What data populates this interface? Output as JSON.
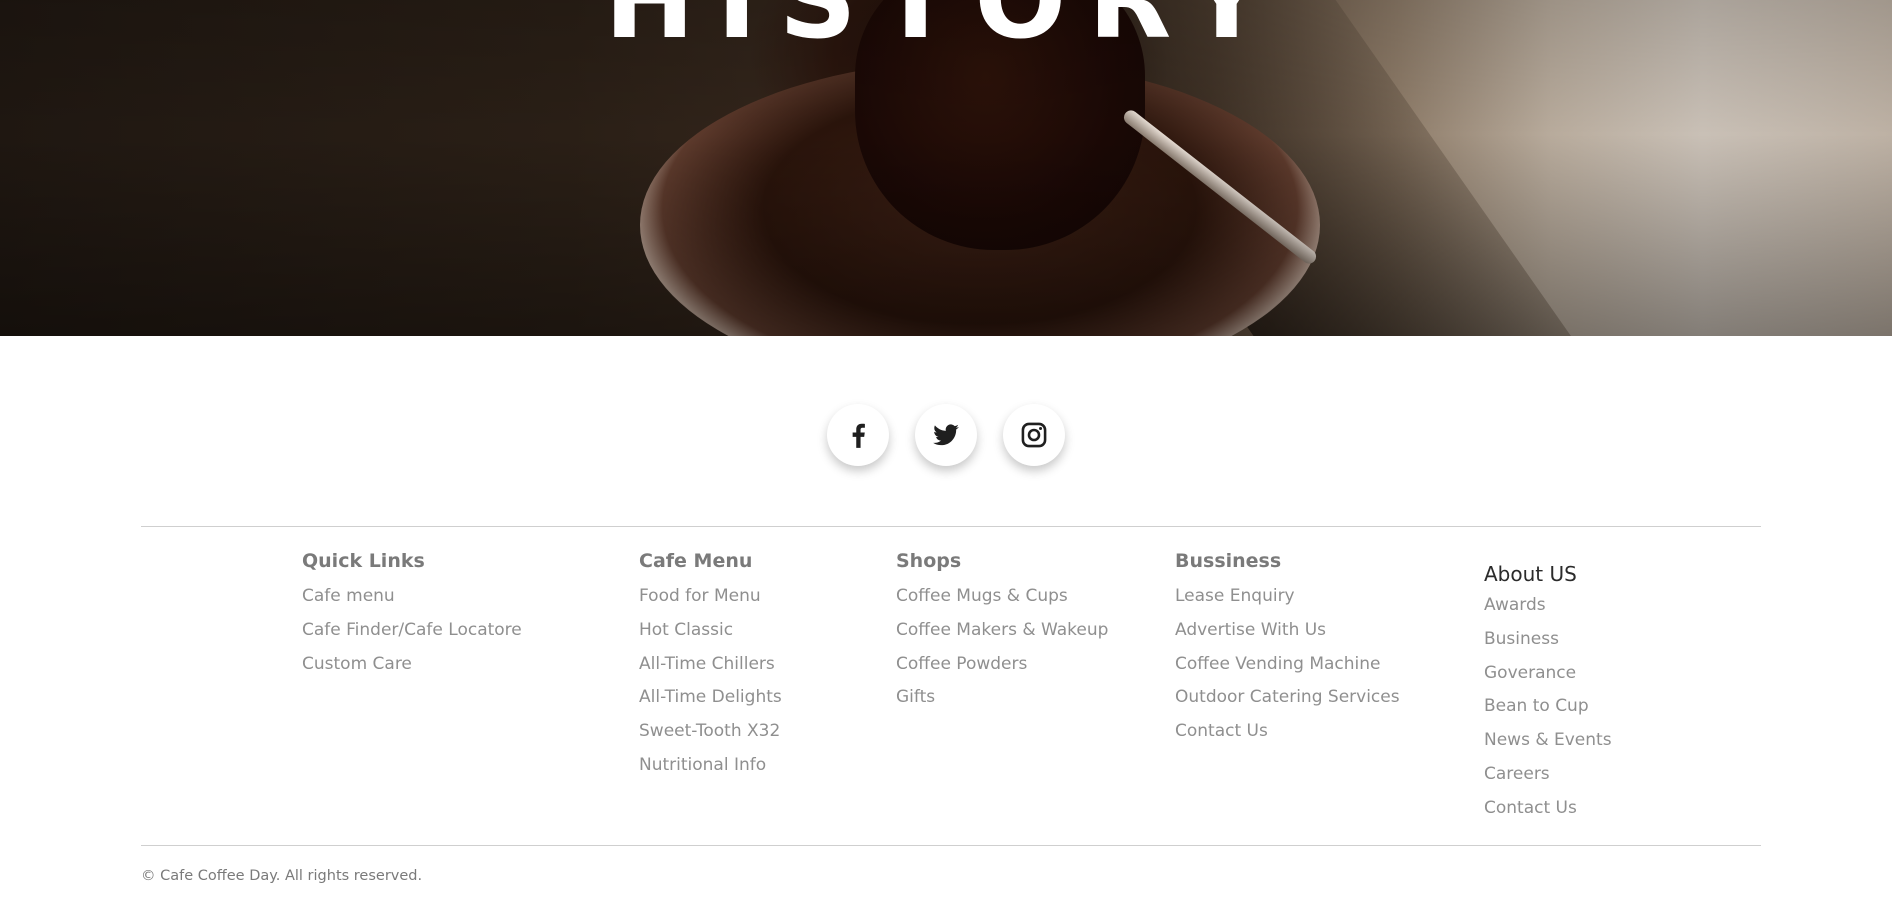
{
  "hero": {
    "title": "HISTORY"
  },
  "social": [
    {
      "name": "facebook",
      "icon": "facebook-icon"
    },
    {
      "name": "twitter",
      "icon": "twitter-icon"
    },
    {
      "name": "instagram",
      "icon": "instagram-icon"
    }
  ],
  "footer": {
    "quick_links": {
      "heading": "Quick Links",
      "items": [
        "Cafe menu",
        "Cafe Finder/Cafe Locatore",
        "Custom Care"
      ]
    },
    "cafe_menu": {
      "heading": "Cafe Menu",
      "items": [
        "Food for Menu",
        "Hot Classic",
        "All-Time Chillers",
        "All-Time Delights",
        "Sweet-Tooth X32",
        "Nutritional Info"
      ]
    },
    "shops": {
      "heading": "Shops",
      "items": [
        "Coffee Mugs & Cups",
        "Coffee Makers & Wakeup",
        "Coffee Powders",
        "Gifts"
      ]
    },
    "bussiness": {
      "heading": "Bussiness",
      "items": [
        "Lease Enquiry",
        "Advertise With Us",
        "Coffee Vending Machine",
        "Outdoor Catering Services",
        "Contact Us"
      ]
    },
    "about": {
      "heading": "About US",
      "items": [
        "Awards",
        "Business",
        "Goverance",
        "Bean to Cup",
        "News & Events",
        "Careers",
        "Contact Us"
      ]
    },
    "copyright": "© Cafe Coffee Day. All rights reserved."
  },
  "colors": {
    "link": "#8f8f8f",
    "heading": "#7a7a7a",
    "rule": "#cfcfcf"
  }
}
